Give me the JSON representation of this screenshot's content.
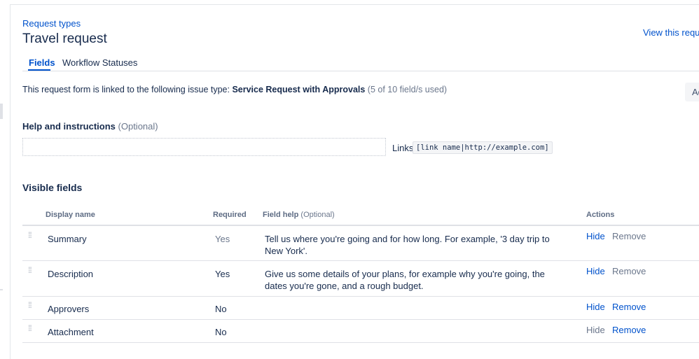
{
  "header": {
    "breadcrumb": "Request types",
    "title": "Travel request",
    "view_link": "View this reque"
  },
  "tabs": [
    {
      "label": "Fields",
      "active": true
    },
    {
      "label": "Workflow Statuses",
      "active": false
    }
  ],
  "linked": {
    "prefix": "This request form is linked to the following issue type: ",
    "issue_type": "Service Request with Approvals",
    "usage": " (5 of 10 field/s used)",
    "add_button": "Ad"
  },
  "help": {
    "label": "Help and instructions",
    "optional": " (Optional)",
    "input_value": "",
    "links_label": "Links",
    "links_code": "[link name|http://example.com]"
  },
  "visible_fields": {
    "title": "Visible fields",
    "columns": {
      "name": "Display name",
      "required": "Required",
      "help": "Field help",
      "help_optional": " (Optional)",
      "actions": "Actions"
    },
    "rows": [
      {
        "name": "Summary",
        "required": "Yes",
        "help": "Tell us where you're going and for how long. For example, '3 day trip to New York'.",
        "hide": "Hide",
        "remove": "Remove"
      },
      {
        "name": "Description",
        "required": "Yes",
        "help": "Give us some details of your plans, for example why you're going, the dates you're gone, and a rough budget.",
        "hide": "Hide",
        "remove": "Remove"
      },
      {
        "name": "Approvers",
        "required": "No",
        "help": "",
        "hide": "Hide",
        "remove": "Remove"
      },
      {
        "name": "Attachment",
        "required": "No",
        "help": "",
        "hide": "Hide",
        "remove": "Remove"
      }
    ]
  },
  "colors": {
    "link": "#0052cc",
    "text": "#172b4d",
    "muted": "#6b778c",
    "border": "#dfe1e6"
  }
}
